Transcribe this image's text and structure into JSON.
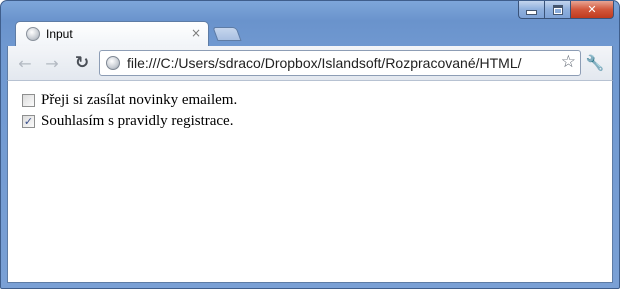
{
  "window": {
    "controls": {
      "minimize_icon": "minimize-icon",
      "maximize_icon": "maximize-icon",
      "close_icon": "close-icon",
      "close_glyph": "✕"
    }
  },
  "tab": {
    "title": "Input",
    "close_glyph": "×",
    "favicon": "globe-icon"
  },
  "toolbar": {
    "back_glyph": "←",
    "forward_glyph": "→",
    "reload_glyph": "↻",
    "url": "file:///C:/Users/sdraco/Dropbox/Islandsoft/Rozpracované/HTML/",
    "star_glyph": "☆",
    "wrench_glyph": "🔧"
  },
  "page": {
    "checkboxes": [
      {
        "label": "Přeji si zasílat novinky emailem.",
        "checked": false
      },
      {
        "label": "Souhlasím s pravidly registrace.",
        "checked": true
      }
    ],
    "check_glyph": "✓"
  },
  "colors": {
    "frame": "#6f98d0",
    "close_button": "#c03a1e",
    "check": "#3a4f8a"
  }
}
